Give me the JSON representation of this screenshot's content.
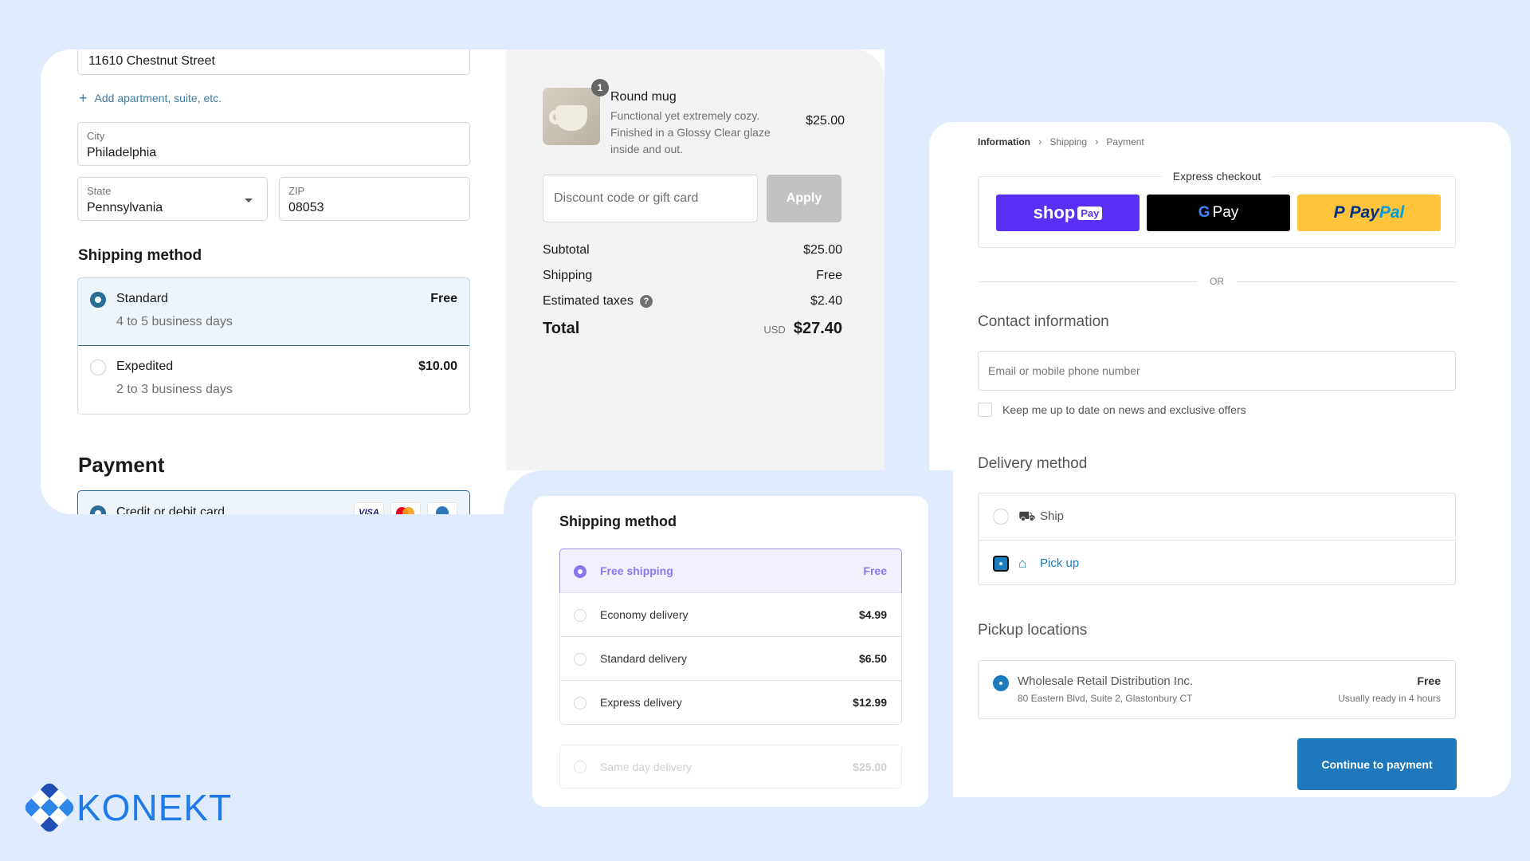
{
  "address": {
    "street": "11610 Chestnut Street",
    "add_apartment": "Add apartment, suite, etc.",
    "city_label": "City",
    "city": "Philadelphia",
    "state_label": "State",
    "state": "Pennsylvania",
    "zip_label": "ZIP",
    "zip": "08053"
  },
  "shipping": {
    "title": "Shipping method",
    "options": [
      {
        "name": "Standard",
        "sub": "4 to 5 business days",
        "price": "Free",
        "selected": true
      },
      {
        "name": "Expedited",
        "sub": "2 to 3 business days",
        "price": "$10.00",
        "selected": false
      }
    ]
  },
  "payment": {
    "title": "Payment",
    "option": "Credit or debit card",
    "cards": [
      "VISA",
      "Mastercard",
      "Diners"
    ]
  },
  "summary": {
    "product": {
      "qty": "1",
      "name": "Round mug",
      "desc": "Functional yet extremely cozy. Finished in a Glossy Clear glaze inside and out.",
      "price": "$25.00"
    },
    "discount_placeholder": "Discount code or gift card",
    "apply": "Apply",
    "rows": [
      {
        "label": "Subtotal",
        "value": "$25.00"
      },
      {
        "label": "Shipping",
        "value": "Free"
      },
      {
        "label": "Estimated taxes",
        "value": "$2.40"
      }
    ],
    "total_label": "Total",
    "currency": "USD",
    "total": "$27.40"
  },
  "mid": {
    "title": "Shipping method",
    "options": [
      {
        "name": "Free shipping",
        "price": "Free",
        "selected": true
      },
      {
        "name": "Economy delivery",
        "price": "$4.99",
        "selected": false
      },
      {
        "name": "Standard delivery",
        "price": "$6.50",
        "selected": false
      },
      {
        "name": "Express delivery",
        "price": "$12.99",
        "selected": false
      }
    ],
    "disabled": {
      "name": "Same day delivery",
      "price": "$25.00"
    }
  },
  "right": {
    "breadcrumbs": [
      "Information",
      "Shipping",
      "Payment"
    ],
    "express_label": "Express checkout",
    "shop_pay": {
      "shop": "shop",
      "pay": "Pay"
    },
    "gpay": {
      "g": "G",
      "pay": "Pay"
    },
    "paypal": {
      "p1": "Pay",
      "p2": "Pal"
    },
    "or": "OR",
    "contact_title": "Contact information",
    "email_placeholder": "Email or mobile phone number",
    "newsletter": "Keep me up to date on news and exclusive offers",
    "delivery_title": "Delivery method",
    "delivery_options": [
      {
        "label": "Ship",
        "icon": "truck-icon",
        "selected": false
      },
      {
        "label": "Pick up",
        "icon": "store-icon",
        "selected": true
      }
    ],
    "pickup_title": "Pickup locations",
    "pickup": {
      "name": "Wholesale Retail Distribution Inc.",
      "address": "80 Eastern Blvd, Suite 2, Glastonbury CT",
      "price": "Free",
      "ready": "Usually ready in 4 hours"
    },
    "continue": "Continue to payment"
  },
  "brand": {
    "name": "KONEKT",
    "color": "#1e7ae6"
  },
  "colors": {
    "accent_blue": "#2a6e93",
    "purple": "#8a77ee",
    "cta": "#1f78bc"
  }
}
